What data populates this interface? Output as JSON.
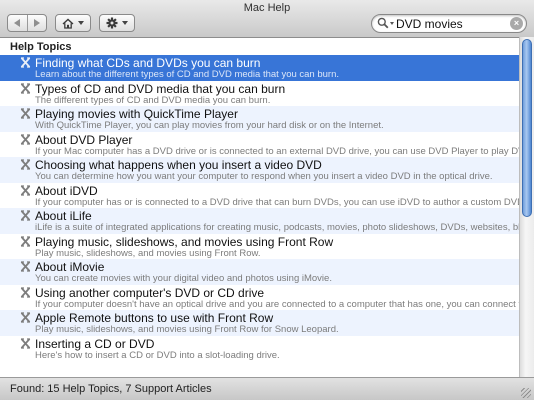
{
  "window": {
    "title": "Mac Help"
  },
  "toolbar": {
    "back_icon": "back-arrow-icon",
    "forward_icon": "forward-arrow-icon",
    "home_icon": "house-icon",
    "action_icon": "gear-icon"
  },
  "search": {
    "value": "DVD movies",
    "placeholder": ""
  },
  "list": {
    "heading": "Help Topics",
    "items": [
      {
        "title": "Finding what CDs and DVDs you can burn",
        "desc": "Learn about the different types of CD and DVD media that you can burn."
      },
      {
        "title": "Types of CD and DVD media that you can burn",
        "desc": "The different types of CD and DVD media you can burn."
      },
      {
        "title": "Playing movies with QuickTime Player",
        "desc": "With QuickTime Player, you can play movies from your hard disk or on the Internet."
      },
      {
        "title": "About DVD Player",
        "desc": "If your Mac computer has a DVD drive or is connected to an external DVD drive, you can use DVD Player to play DVDs ..."
      },
      {
        "title": "Choosing what happens when you insert a video DVD",
        "desc": "You can determine how you want your computer to respond when you insert a video DVD in the optical drive."
      },
      {
        "title": "About iDVD",
        "desc": "If your computer has or is connected to a DVD drive that can burn DVDs, you can use iDVD to author a custom DVD c..."
      },
      {
        "title": "About iLife",
        "desc": "iLife is a suite of integrated applications for creating music, podcasts, movies, photo slideshows, DVDs, websites, blo..."
      },
      {
        "title": "Playing music, slideshows, and movies using Front Row",
        "desc": "Play music, slideshows, and movies using Front Row."
      },
      {
        "title": "About iMovie",
        "desc": "You can create movies with your digital video and photos using iMovie."
      },
      {
        "title": "Using another computer's DVD or CD drive",
        "desc": "If your computer doesn't have an optical drive and you are connected to a computer that has one, you can connect to..."
      },
      {
        "title": "Apple Remote buttons to use with Front Row",
        "desc": "Play music, slideshows, and movies using Front Row for Snow Leopard."
      },
      {
        "title": "Inserting a CD or DVD",
        "desc": "Here's how to insert a CD or DVD into a slot-loading drive."
      }
    ]
  },
  "status": {
    "text": "Found: 15 Help Topics, 7 Support Articles"
  },
  "colors": {
    "selection": "#3875d7",
    "alt_row": "#edf3fe"
  }
}
